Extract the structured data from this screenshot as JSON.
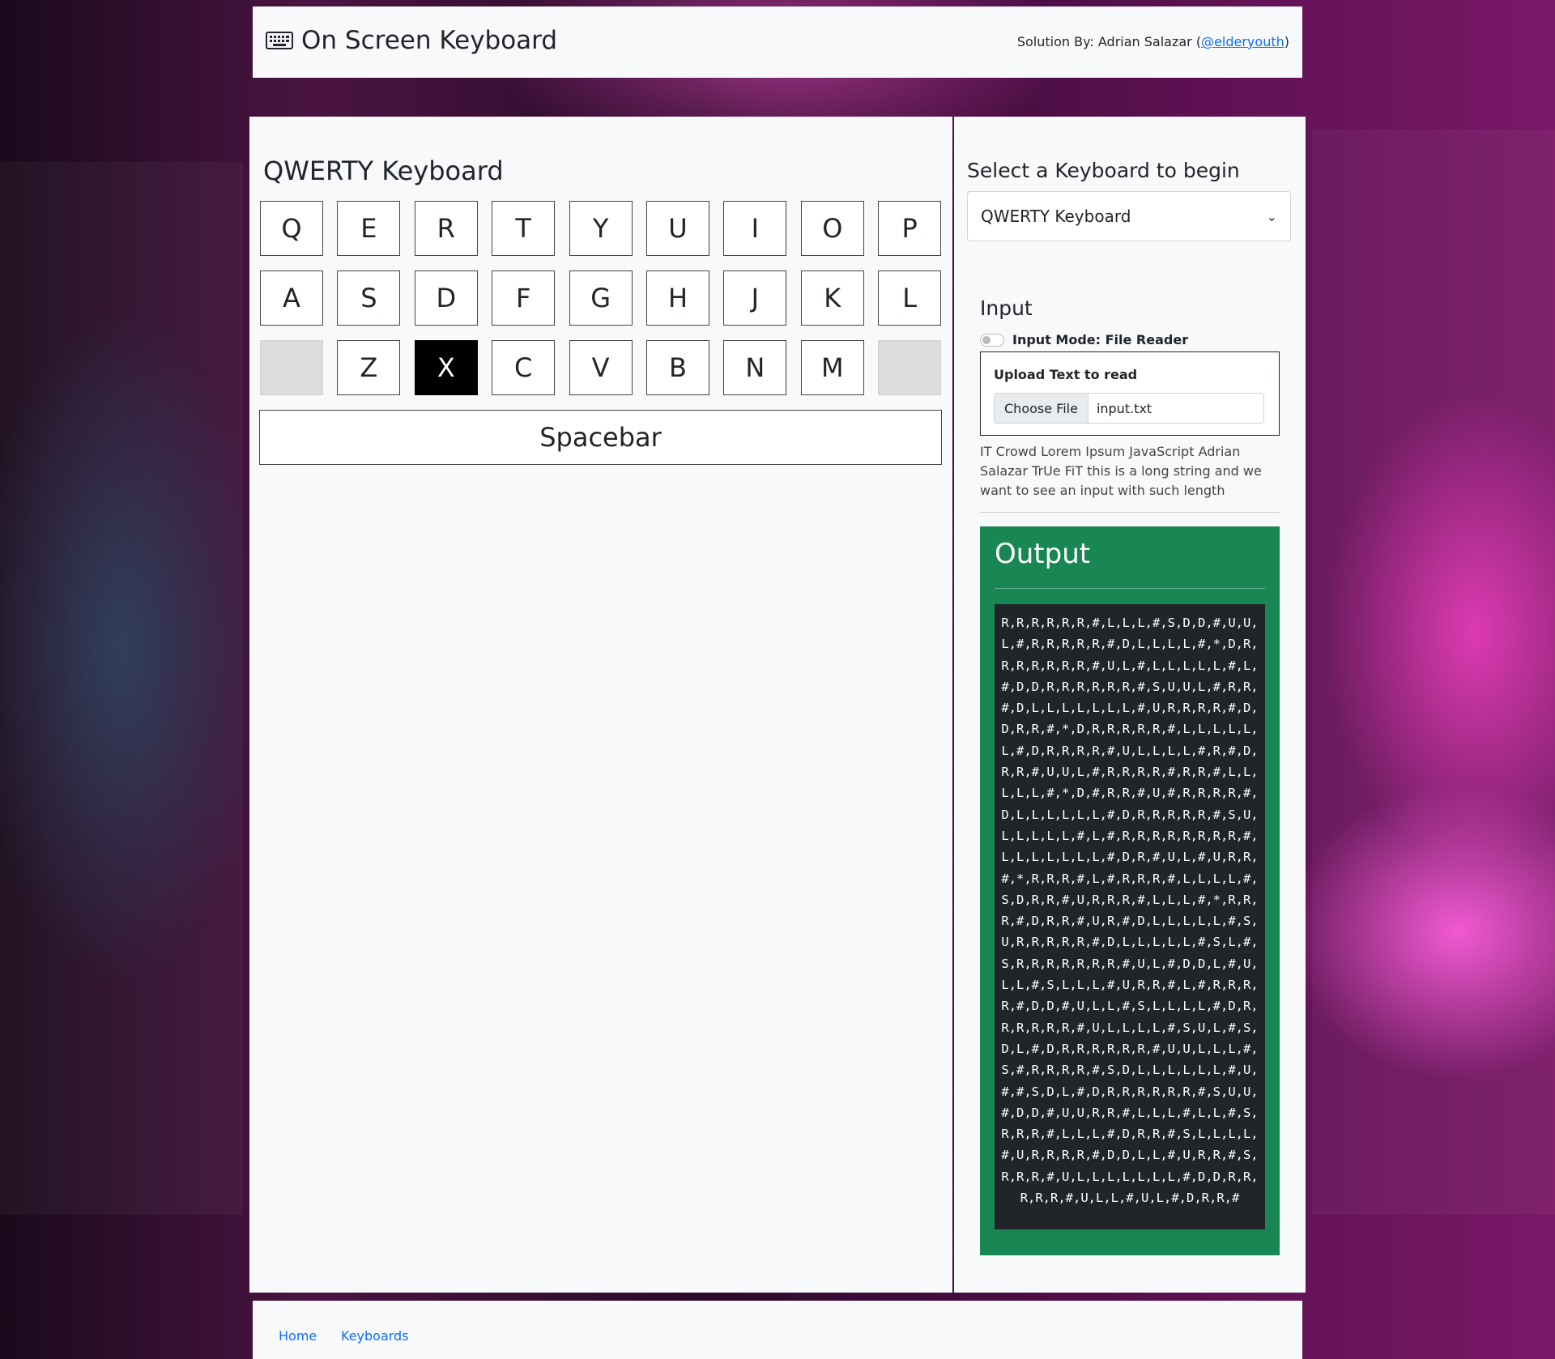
{
  "header": {
    "title": "On Screen Keyboard",
    "credit_prefix": "Solution By: Adrian Salazar (",
    "credit_handle": "@elderyouth",
    "credit_suffix": ")"
  },
  "keyboard": {
    "title": "QWERTY Keyboard",
    "rows": [
      [
        "Q",
        "E",
        "R",
        "T",
        "Y",
        "U",
        "I",
        "O",
        "P"
      ],
      [
        "A",
        "S",
        "D",
        "F",
        "G",
        "H",
        "J",
        "K",
        "L"
      ],
      [
        "",
        "Z",
        "X",
        "C",
        "V",
        "B",
        "N",
        "M",
        ""
      ]
    ],
    "active_key": "X",
    "spacebar_label": "Spacebar"
  },
  "sidebar": {
    "select_label": "Select a Keyboard to begin",
    "select_value": "QWERTY Keyboard",
    "input_title": "Input",
    "mode_label": "Input Mode: File Reader",
    "mode_enabled": false,
    "upload_label": "Upload Text to read",
    "file_button": "Choose File",
    "file_name": "input.txt",
    "input_text": "IT Crowd Lorem Ipsum JavaScript Adrian Salazar TrUe FiT this is a long string and we want to see an input with such length",
    "output_title": "Output",
    "output_text": "R,R,R,R,R,R,#,L,L,L,#,S,D,D,#,U,U,L,#,R,R,R,R,R,#,D,L,L,L,L,#,*,D,R,R,R,R,R,R,R,#,U,L,#,L,L,L,L,L,#,L,#,D,D,R,R,R,R,R,R,#,S,U,U,L,#,R,R,#,D,L,L,L,L,L,L,L,#,U,R,R,R,R,#,D,D,R,R,#,*,D,R,R,R,R,R,#,L,L,L,L,L,L,#,D,R,R,R,R,#,U,L,L,L,L,#,R,#,D,R,R,#,U,U,L,#,R,R,R,R,#,R,R,#,L,L,L,L,L,#,*,D,#,R,R,#,U,#,R,R,R,R,#,D,L,L,L,L,L,L,#,D,R,R,R,R,R,#,S,U,L,L,L,L,L,#,L,#,R,R,R,R,R,R,R,R,#,L,L,L,L,L,L,L,#,D,R,#,U,L,#,U,R,R,#,*,R,R,R,#,L,#,R,R,R,#,L,L,L,L,#,S,D,R,R,#,U,R,R,R,#,L,L,L,#,*,R,R,R,#,D,R,R,#,U,R,#,D,L,L,L,L,L,#,S,U,R,R,R,R,R,#,D,L,L,L,L,L,#,S,L,#,S,R,R,R,R,R,R,R,#,U,L,#,D,D,L,#,U,L,L,#,S,L,L,L,#,U,R,R,#,L,#,R,R,R,R,#,D,D,#,U,L,L,#,S,L,L,L,L,#,D,R,R,R,R,R,R,#,U,L,L,L,L,#,S,U,L,#,S,D,L,#,D,R,R,R,R,R,R,#,U,U,L,L,L,#,S,#,R,R,R,R,#,S,D,L,L,L,L,L,L,#,U,#,#,S,D,L,#,D,R,R,R,R,R,R,#,S,U,U,#,D,D,#,U,U,R,R,#,L,L,L,#,L,L,#,S,R,R,R,#,L,L,L,#,D,R,R,#,S,L,L,L,L,#,U,R,R,R,R,#,D,D,L,L,#,U,R,R,#,S,R,R,R,#,U,L,L,L,L,L,L,L,#,D,D,R,R,R,R,R,#,U,L,L,#,U,L,#,D,R,R,#"
  },
  "footer": {
    "links": [
      "Home",
      "Keyboards"
    ]
  }
}
